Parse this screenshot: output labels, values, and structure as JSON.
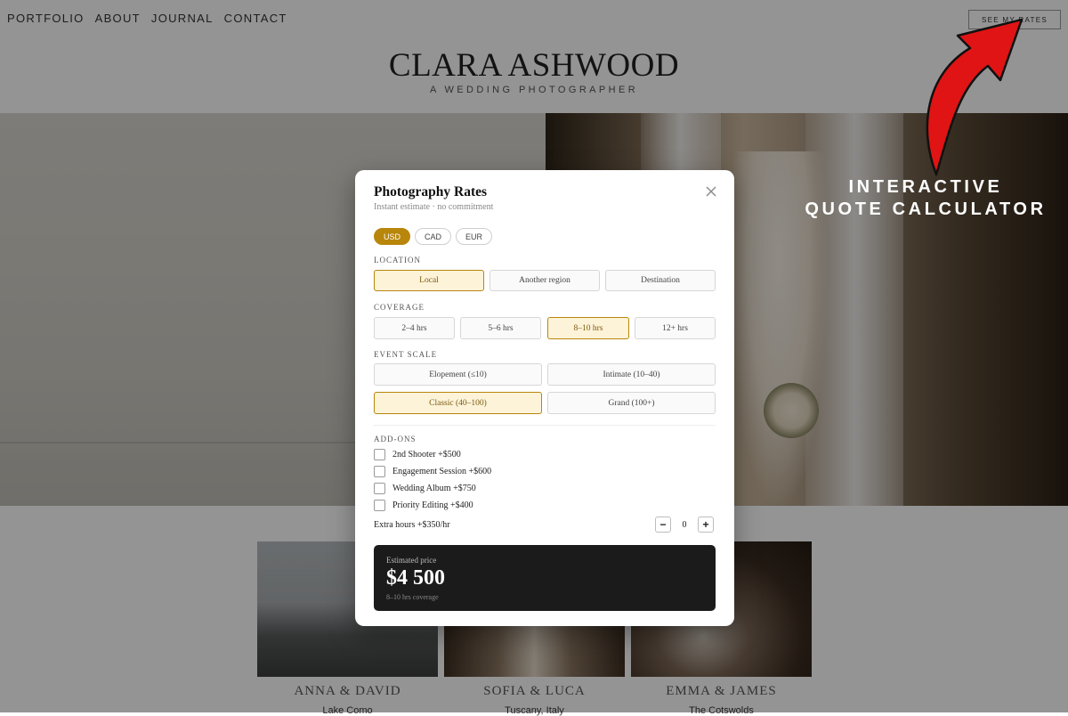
{
  "site": {
    "nav": [
      "PORTFOLIO",
      "ABOUT",
      "JOURNAL",
      "CONTACT"
    ],
    "rates_button": "SEE MY RATES",
    "brand_name": "CLARA ASHWOOD",
    "brand_tagline": "A WEDDING PHOTOGRAPHER",
    "gallery": [
      {
        "names": "ANNA & DAVID",
        "place": "Lake Como"
      },
      {
        "names": "SOFIA & LUCA",
        "place": "Tuscany, Italy"
      },
      {
        "names": "EMMA & JAMES",
        "place": "The Cotswolds"
      }
    ]
  },
  "promo": {
    "line1": "INTERACTIVE",
    "line2": "QUOTE CALCULATOR",
    "arrow_color": "#e01414"
  },
  "modal": {
    "title": "Photography Rates",
    "subtitle": "Instant estimate · no commitment",
    "close_icon": "close-icon",
    "currencies": [
      "USD",
      "CAD",
      "EUR"
    ],
    "selected_currency": "USD",
    "location": {
      "label": "LOCATION",
      "options": [
        "Local",
        "Another region",
        "Destination"
      ],
      "selected": "Local"
    },
    "coverage": {
      "label": "COVERAGE",
      "options": [
        "2–4 hrs",
        "5–6 hrs",
        "8–10 hrs",
        "12+ hrs"
      ],
      "selected": "8–10 hrs"
    },
    "event_scale": {
      "label": "EVENT SCALE",
      "options": [
        "Elopement (≤10)",
        "Intimate (10–40)",
        "Classic (40–100)",
        "Grand (100+)"
      ],
      "selected": "Classic (40–100)"
    },
    "addons": {
      "label": "ADD-ONS",
      "items": [
        "2nd Shooter +$500",
        "Engagement Session +$600",
        "Wedding Album +$750",
        "Priority Editing +$400"
      ],
      "checked": [
        false,
        false,
        false,
        false
      ]
    },
    "extra_hours": {
      "label": "Extra hours +$350/hr",
      "value": "0",
      "minus": "−",
      "plus": "+"
    },
    "estimate": {
      "label": "Estimated price",
      "amount": "$4 500",
      "note": "8–10 hrs coverage"
    },
    "accent_color": "#b8860b"
  }
}
